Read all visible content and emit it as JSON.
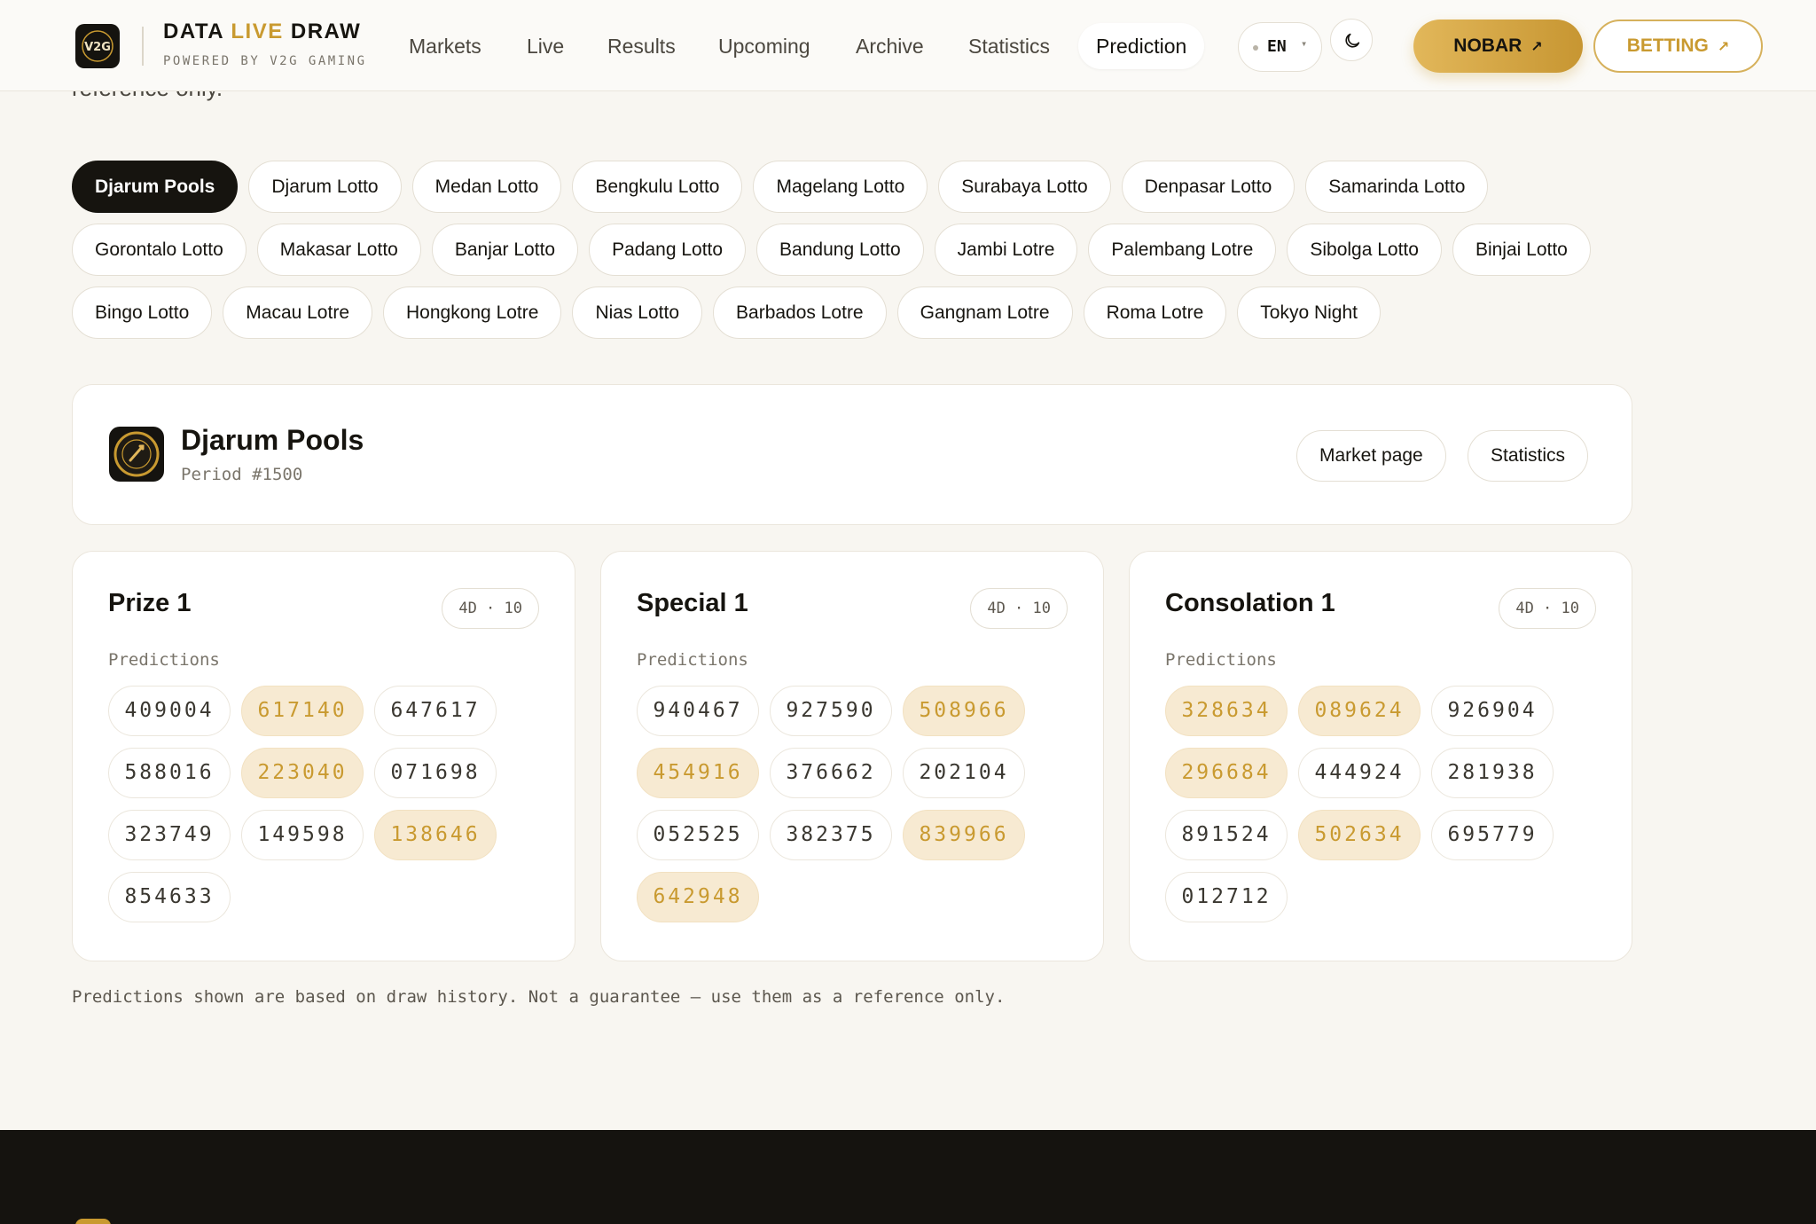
{
  "header": {
    "brand_prefix": "DATA",
    "brand_accent": "LIVE",
    "brand_suffix": "DRAW",
    "brand_sub": "POWERED BY V2G GAMING",
    "nav": [
      "Markets",
      "Live",
      "Results",
      "Upcoming",
      "Archive",
      "Statistics",
      "Prediction"
    ],
    "active_nav": "Prediction",
    "lang": "EN",
    "nobar_label": "NOBAR",
    "betting_label": "BETTING",
    "arrow": "↗"
  },
  "intro_clip": "reference only.",
  "markets": [
    "Djarum Pools",
    "Djarum Lotto",
    "Medan Lotto",
    "Bengkulu Lotto",
    "Magelang Lotto",
    "Surabaya Lotto",
    "Denpasar Lotto",
    "Samarinda Lotto",
    "Gorontalo Lotto",
    "Makasar Lotto",
    "Banjar Lotto",
    "Padang Lotto",
    "Bandung Lotto",
    "Jambi Lotre",
    "Palembang Lotre",
    "Sibolga Lotto",
    "Binjai Lotto",
    "Bingo Lotto",
    "Macau Lotre",
    "Hongkong Lotre",
    "Nias Lotto",
    "Barbados Lotre",
    "Gangnam Lotre",
    "Roma Lotre",
    "Tokyo Night"
  ],
  "active_market": "Djarum Pools",
  "market_card": {
    "name": "Djarum Pools",
    "period": "Period #1500",
    "market_page_label": "Market page",
    "statistics_label": "Statistics"
  },
  "predictions_label": "Predictions",
  "cards": [
    {
      "title": "Prize 1",
      "badge": "4D · 10",
      "numbers": [
        {
          "value": "409004",
          "hl": false
        },
        {
          "value": "617140",
          "hl": true
        },
        {
          "value": "647617",
          "hl": false
        },
        {
          "value": "588016",
          "hl": false
        },
        {
          "value": "223040",
          "hl": true
        },
        {
          "value": "071698",
          "hl": false
        },
        {
          "value": "323749",
          "hl": false
        },
        {
          "value": "149598",
          "hl": false
        },
        {
          "value": "138646",
          "hl": true
        },
        {
          "value": "854633",
          "hl": false
        }
      ]
    },
    {
      "title": "Special 1",
      "badge": "4D · 10",
      "numbers": [
        {
          "value": "940467",
          "hl": false
        },
        {
          "value": "927590",
          "hl": false
        },
        {
          "value": "508966",
          "hl": true
        },
        {
          "value": "454916",
          "hl": true
        },
        {
          "value": "376662",
          "hl": false
        },
        {
          "value": "202104",
          "hl": false
        },
        {
          "value": "052525",
          "hl": false
        },
        {
          "value": "382375",
          "hl": false
        },
        {
          "value": "839966",
          "hl": true
        },
        {
          "value": "642948",
          "hl": true
        }
      ]
    },
    {
      "title": "Consolation 1",
      "badge": "4D · 10",
      "numbers": [
        {
          "value": "328634",
          "hl": true
        },
        {
          "value": "089624",
          "hl": true
        },
        {
          "value": "926904",
          "hl": false
        },
        {
          "value": "296684",
          "hl": true
        },
        {
          "value": "444924",
          "hl": false
        },
        {
          "value": "281938",
          "hl": false
        },
        {
          "value": "891524",
          "hl": false
        },
        {
          "value": "502634",
          "hl": true
        },
        {
          "value": "695779",
          "hl": false
        },
        {
          "value": "012712",
          "hl": false
        }
      ]
    }
  ],
  "disclaimer": "Predictions shown are based on draw history. Not a guarantee — use them as a reference only.",
  "colors": {
    "accent": "#c99a30",
    "dark": "#16140f",
    "highlight_bg": "#f7ead2",
    "page_bg": "#f8f6f1"
  },
  "icons": {
    "logo": "v2g-logo-icon",
    "theme": "moon-icon",
    "market": "djarum-pools-logo-icon",
    "arrow": "arrow-up-right-icon"
  }
}
